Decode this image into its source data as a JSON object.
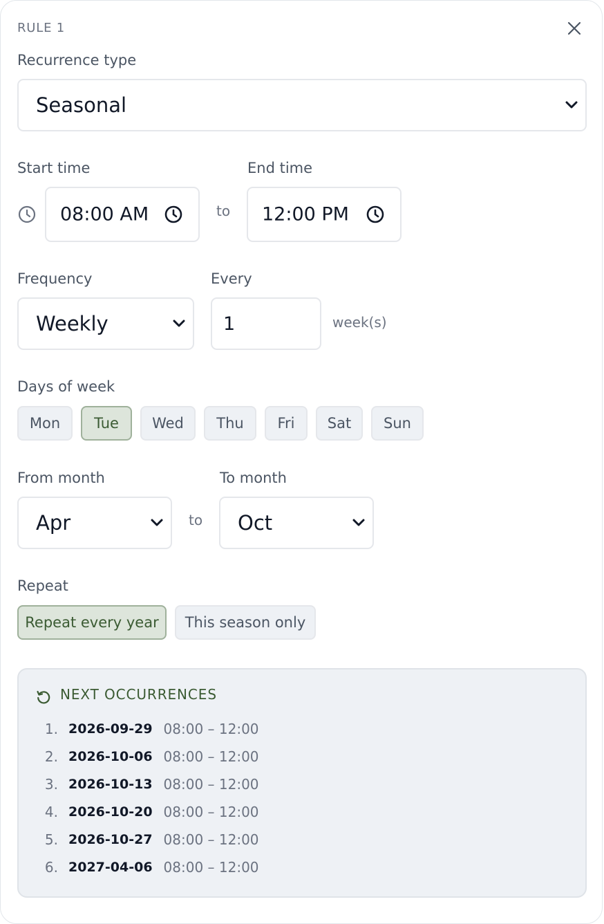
{
  "rule": {
    "title": "RULE 1"
  },
  "recurrence": {
    "label": "Recurrence type",
    "value": "Seasonal"
  },
  "time": {
    "start_label": "Start time",
    "end_label": "End time",
    "start_value": "08:00 AM",
    "end_value": "12:00 PM",
    "separator": "to"
  },
  "frequency": {
    "label": "Frequency",
    "value": "Weekly",
    "every_label": "Every",
    "every_value": "1",
    "unit": "week(s)"
  },
  "days": {
    "label": "Days of week",
    "items": [
      {
        "label": "Mon",
        "selected": false
      },
      {
        "label": "Tue",
        "selected": true
      },
      {
        "label": "Wed",
        "selected": false
      },
      {
        "label": "Thu",
        "selected": false
      },
      {
        "label": "Fri",
        "selected": false
      },
      {
        "label": "Sat",
        "selected": false
      },
      {
        "label": "Sun",
        "selected": false
      }
    ]
  },
  "months": {
    "from_label": "From month",
    "to_label": "To month",
    "from_value": "Apr",
    "to_value": "Oct",
    "separator": "to"
  },
  "repeat": {
    "label": "Repeat",
    "options": [
      {
        "label": "Repeat every year",
        "selected": true
      },
      {
        "label": "This season only",
        "selected": false
      }
    ]
  },
  "occurrences": {
    "title": "NEXT OCCURRENCES",
    "items": [
      {
        "index": "1.",
        "date": "2026-09-29",
        "time": "08:00 – 12:00"
      },
      {
        "index": "2.",
        "date": "2026-10-06",
        "time": "08:00 – 12:00"
      },
      {
        "index": "3.",
        "date": "2026-10-13",
        "time": "08:00 – 12:00"
      },
      {
        "index": "4.",
        "date": "2026-10-20",
        "time": "08:00 – 12:00"
      },
      {
        "index": "5.",
        "date": "2026-10-27",
        "time": "08:00 – 12:00"
      },
      {
        "index": "6.",
        "date": "2027-04-06",
        "time": "08:00 – 12:00"
      }
    ]
  },
  "colors": {
    "accent_green": "#3b5b33",
    "selected_chip_bg": "#dde5db",
    "chip_bg": "#eef1f5",
    "border": "#e5e7eb"
  },
  "icons": {
    "close": "close-icon",
    "clock": "clock-icon",
    "chevron": "chevron-down-icon",
    "refresh": "refresh-icon"
  }
}
